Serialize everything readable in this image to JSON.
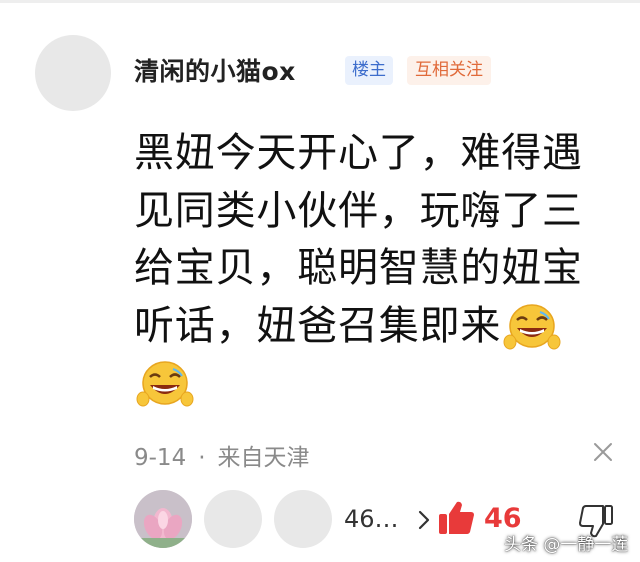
{
  "comment": {
    "username": "清闲的小猫ox",
    "badge_op": "楼主",
    "badge_mutual": "互相关注",
    "text": "黑妞今天开心了，难得遇见同类小伙伴，玩嗨了三给宝贝，聪明智慧的妞宝听话，妞爸召集即来",
    "emojis": [
      "grin-emoji",
      "grin-emoji"
    ],
    "date": "9-14",
    "separator": "·",
    "location": "来自天津"
  },
  "footer": {
    "reply_count": "46…",
    "like_count": "46"
  },
  "watermark": "头条 @一静一莲",
  "colors": {
    "op_badge": "#3d6dcc",
    "mutual_badge": "#e06a3a",
    "like": "#e83a3a",
    "meta": "#8a8a8a"
  }
}
